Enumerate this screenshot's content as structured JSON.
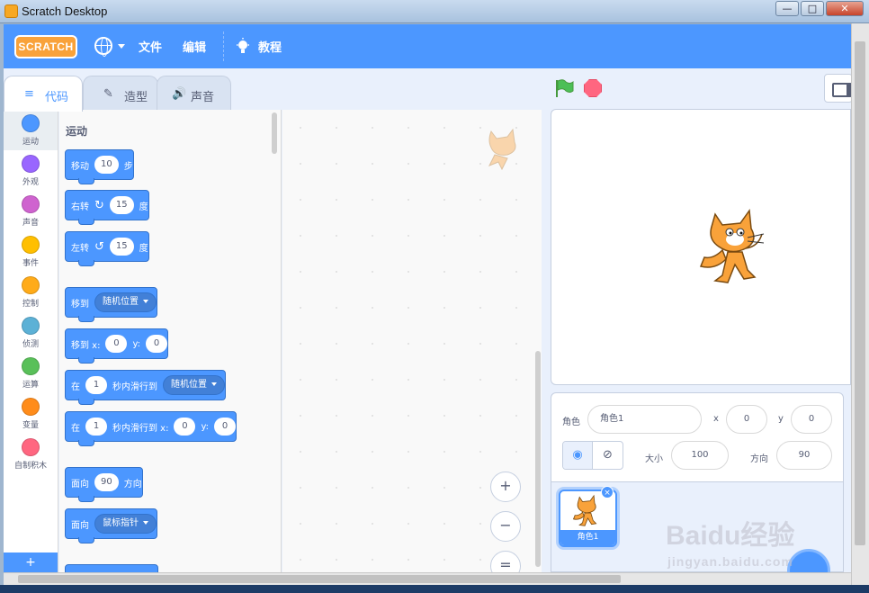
{
  "window": {
    "title": "Scratch Desktop"
  },
  "menubar": {
    "logo": "SCRATCH",
    "file": "文件",
    "edit": "编辑",
    "tutorials": "教程"
  },
  "tabs": [
    {
      "label": "代码",
      "icon": "≡",
      "active": true
    },
    {
      "label": "造型",
      "icon": "✎",
      "active": false
    },
    {
      "label": "声音",
      "icon": "🔊",
      "active": false
    }
  ],
  "categories": [
    {
      "label": "运动",
      "color": "#4c97ff"
    },
    {
      "label": "外观",
      "color": "#9966ff"
    },
    {
      "label": "声音",
      "color": "#cf63cf"
    },
    {
      "label": "事件",
      "color": "#ffbf00"
    },
    {
      "label": "控制",
      "color": "#ffab19"
    },
    {
      "label": "侦测",
      "color": "#5cb1d6"
    },
    {
      "label": "运算",
      "color": "#59c059"
    },
    {
      "label": "变量",
      "color": "#ff8c1a"
    },
    {
      "label": "自制积木",
      "color": "#ff6680"
    }
  ],
  "categories_add": "+",
  "palette": {
    "title": "运动",
    "move": {
      "a": "移动",
      "v": "10",
      "b": "步"
    },
    "turn_right": {
      "a": "右转",
      "icon": "↻",
      "v": "15",
      "b": "度"
    },
    "turn_left": {
      "a": "左转",
      "icon": "↺",
      "v": "15",
      "b": "度"
    },
    "goto": {
      "a": "移到",
      "dd": "随机位置"
    },
    "gotoxy": {
      "a": "移到 x:",
      "x": "0",
      "y_label": "y:",
      "y": "0"
    },
    "glide": {
      "a": "在",
      "v": "1",
      "b": "秒内滑行到",
      "dd": "随机位置"
    },
    "glidexy": {
      "a": "在",
      "v": "1",
      "b": "秒内滑行到 x:",
      "x": "0",
      "y_label": "y:",
      "y": "0"
    },
    "point": {
      "a": "面向",
      "v": "90",
      "b": "方向"
    },
    "point_towards": {
      "a": "面向",
      "dd": "鼠标指针"
    }
  },
  "zoom": {
    "in": "+",
    "out": "−",
    "reset": "="
  },
  "sprite_info": {
    "sprite_label": "角色",
    "sprite_name": "角色1",
    "x_label": "x",
    "x": "0",
    "y_label": "y",
    "y": "0",
    "size_label": "大小",
    "size": "100",
    "direction_label": "方向",
    "direction": "90"
  },
  "sprite_list": {
    "card_name": "角色1",
    "delete": "×"
  },
  "watermark": {
    "big": "Baidu经验",
    "small": "jingyan.baidu.com"
  },
  "colors": {
    "accent": "#4c97ff",
    "motion": "#4c97ff",
    "flag": "#4cbf56",
    "stop": "#ff6680"
  },
  "icons": [
    "scratch-logo",
    "globe-icon",
    "bulb-icon",
    "code-icon",
    "brush-icon",
    "speaker-icon",
    "green-flag-icon",
    "stop-icon",
    "stage-mode-icon",
    "eye-icon",
    "eye-off-icon",
    "zoom-in-icon",
    "zoom-out-icon",
    "zoom-reset-icon"
  ]
}
